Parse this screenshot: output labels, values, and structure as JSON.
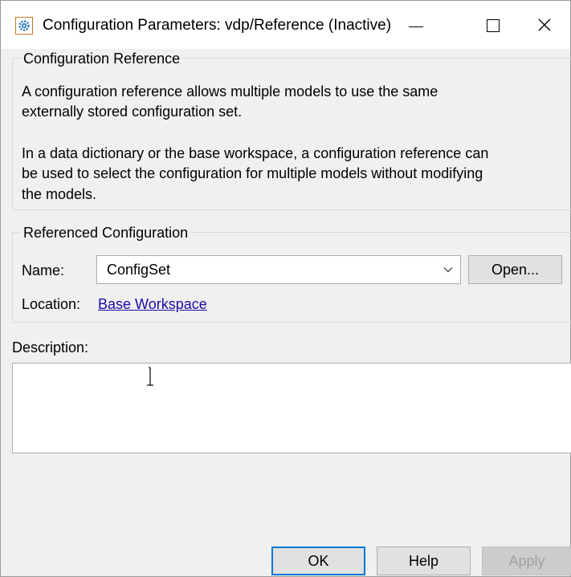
{
  "window": {
    "title": "Configuration Parameters: vdp/Reference (Inactive)",
    "icon": "gear-icon",
    "controls": [
      "minimize-icon",
      "maximize-icon",
      "close-icon"
    ],
    "close_glyph": "✕"
  },
  "configuration_reference": {
    "title": "Configuration Reference",
    "para1_line1": "A configuration reference allows multiple models to use the same",
    "para1_line2": "externally stored configuration set.",
    "para2_line1": "In a data dictionary or the base workspace, a configuration reference can",
    "para2_line2": "be used to select the configuration for multiple models without modifying",
    "para2_line3": "the models."
  },
  "referenced_configuration": {
    "title": "Referenced Configuration",
    "name_label": "Name:",
    "name_value": "ConfigSet",
    "open_label": "Open...",
    "location_label": "Location:",
    "location_link": "Base Workspace"
  },
  "description": {
    "label": "Description:",
    "value": ""
  },
  "buttons": {
    "ok": "OK",
    "help": "Help",
    "apply": "Apply"
  },
  "colors": {
    "link": "#1a0dab",
    "focus_border": "#0078d7",
    "dialog_bg": "#f0f0f0"
  }
}
